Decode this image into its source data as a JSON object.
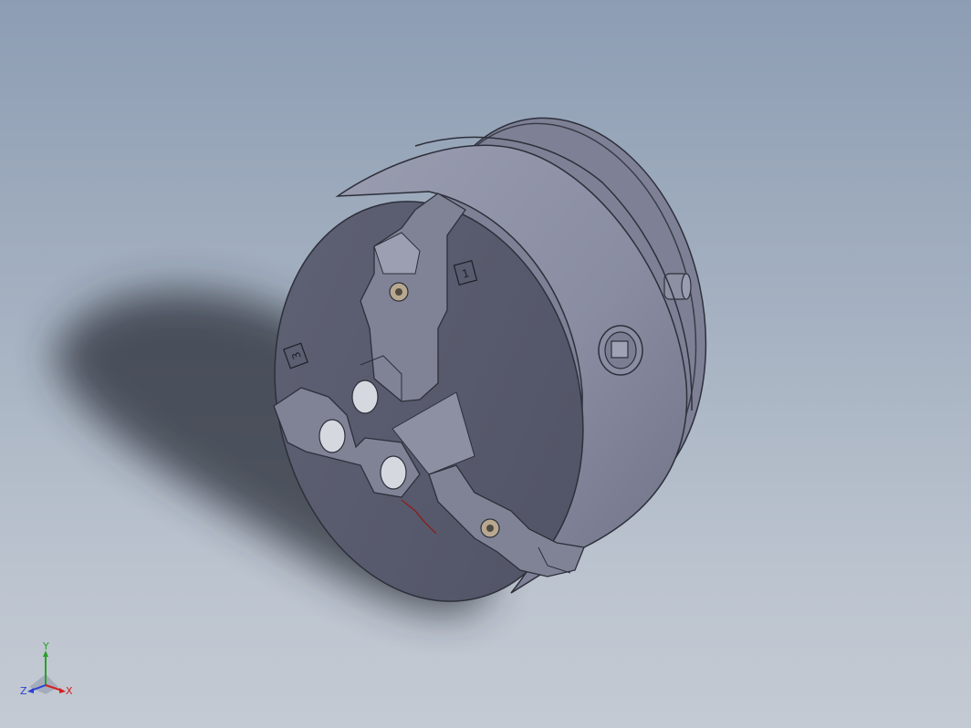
{
  "viewport": {
    "jaw_labels": [
      "1",
      "3"
    ]
  },
  "triad": {
    "x_label": "X",
    "y_label": "Y",
    "z_label": "Z",
    "x_color": "#d42020",
    "y_color": "#2aa02a",
    "z_color": "#2a3fd4"
  },
  "model": {
    "body_color": "#6a6d80",
    "face_color": "#595c6d",
    "side_color": "#8f92a6",
    "shadow_color": "#2c2f38",
    "icons": [
      "three-jaw-chuck",
      "coordinate-triad"
    ]
  }
}
